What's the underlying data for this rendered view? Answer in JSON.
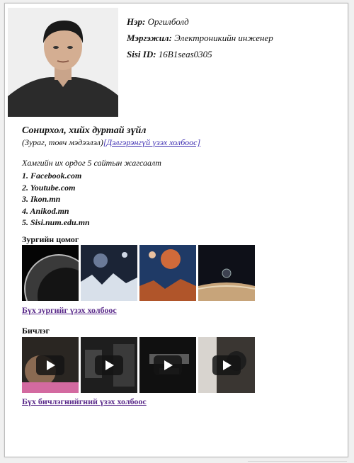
{
  "profile": {
    "name_label": "Нэр:",
    "name_value": "Оргилболд",
    "job_label": "Мэргэжил:",
    "job_value": "Электроникийн инженер",
    "id_label": "Sisi ID:",
    "id_value": "16B1seas0305"
  },
  "interest": {
    "title": "Сонирхол, хийх дуртай зүйл",
    "subtitle": "(Зураг, товч мэдээлэл)",
    "link": "[Дэлгэрэнгүй үзэх холбоос]"
  },
  "sites": {
    "caption": "Хамгийн их ордог 5 сайтын жагсаалт",
    "items": [
      "1. Facebook.com",
      "2. Youtube.com",
      "3. Ikon.mn",
      "4. Anikod.mn",
      "5. Sisi.num.edu.mn"
    ]
  },
  "gallery": {
    "title": "Зургийн цомог",
    "link": "Бүх зургийг үзэх холбоос",
    "images": [
      "planet-icon",
      "planet-icon",
      "planet-icon",
      "planet-icon"
    ]
  },
  "videos": {
    "title": "Бичлэг",
    "link": "Бүх бичлэгнийгний үзэх холбоос",
    "items": [
      "play-icon",
      "play-icon",
      "play-icon",
      "play-icon"
    ]
  }
}
